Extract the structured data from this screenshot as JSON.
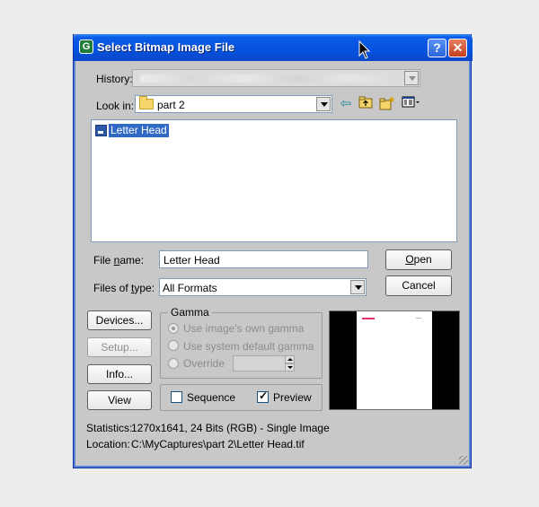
{
  "window": {
    "title": "Select Bitmap Image File",
    "help_label": "?",
    "close_label": "✕"
  },
  "history": {
    "label": "History:"
  },
  "lookin": {
    "label": "Look in:",
    "value": "part 2"
  },
  "filelist": {
    "items": [
      {
        "name": "Letter Head",
        "selected": true
      }
    ]
  },
  "filename": {
    "label": "File name:",
    "value": "Letter Head"
  },
  "filetype": {
    "label": "Files of type:",
    "value": "All Formats"
  },
  "buttons": {
    "open": "Open",
    "cancel": "Cancel",
    "devices": "Devices...",
    "setup": "Setup...",
    "info": "Info...",
    "view": "View"
  },
  "gamma": {
    "title": "Gamma",
    "options": [
      {
        "label": "Use image's own gamma",
        "checked": true
      },
      {
        "label": "Use system default gamma",
        "checked": false
      },
      {
        "label": "Override",
        "checked": false
      }
    ]
  },
  "options": {
    "sequence": {
      "label": "Sequence",
      "checked": false
    },
    "preview": {
      "label": "Preview",
      "checked": true
    }
  },
  "info": {
    "statistics_label": "Statistics:",
    "statistics_value": "1270x1641, 24 Bits (RGB) - Single Image",
    "location_label": "Location:",
    "location_value": "C:\\MyCaptures\\part 2\\Letter Head.tif"
  }
}
